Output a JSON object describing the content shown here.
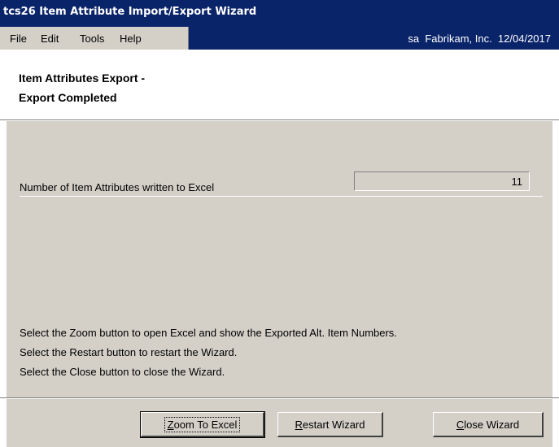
{
  "window": {
    "title": "tcs26 Item Attribute Import/Export Wizard"
  },
  "menu": {
    "items": [
      "File",
      "Edit",
      "Tools",
      "Help"
    ],
    "info": "sa  Fabrikam, Inc.  12/04/2017"
  },
  "header": {
    "title_line1": "Item Attributes Export -",
    "title_line2": "Export Completed"
  },
  "content": {
    "field_label": "Number of Item Attributes written to Excel",
    "field_value": "11",
    "instructions": [
      "Select the Zoom button to open Excel and show the Exported Alt. Item Numbers.",
      "Select the Restart button to restart the Wizard.",
      "Select the Close button to close the Wizard."
    ]
  },
  "buttons": {
    "zoom": {
      "accel": "Z",
      "rest": "oom To Excel"
    },
    "restart": {
      "accel": "R",
      "rest": "estart Wizard"
    },
    "close": {
      "pre": "",
      "accel": "C",
      "rest": "lose Wizard"
    }
  }
}
